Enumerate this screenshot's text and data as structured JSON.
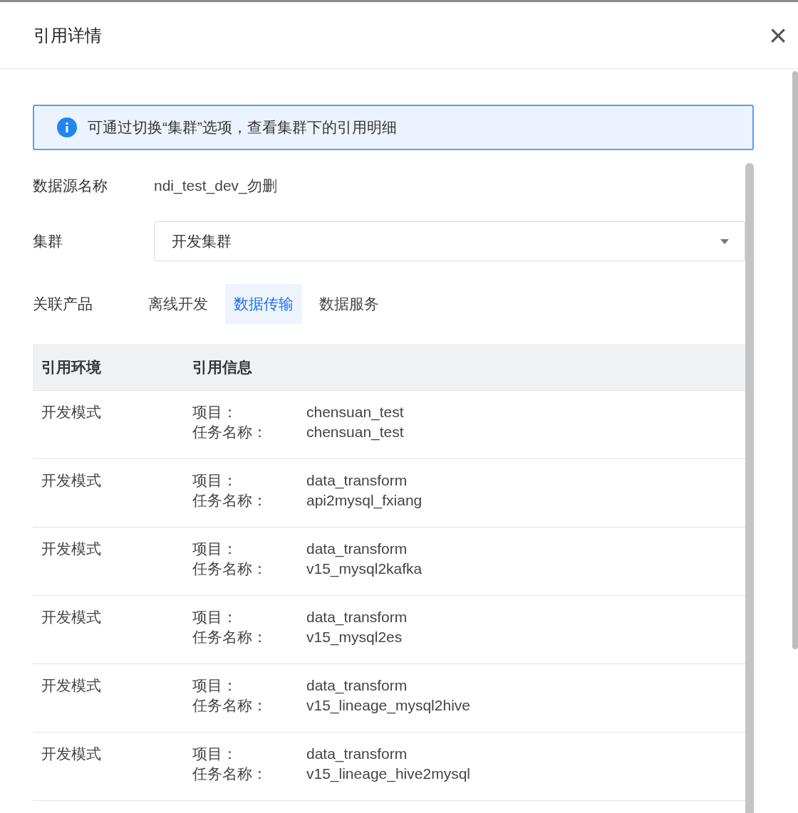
{
  "dialog": {
    "title": "引用详情",
    "close": "×"
  },
  "info": {
    "text": "可通过切换“集群”选项，查看集群下的引用明细"
  },
  "datasource": {
    "label": "数据源名称",
    "value": "ndi_test_dev_勿删"
  },
  "cluster": {
    "label": "集群",
    "value": "开发集群"
  },
  "products": {
    "label": "关联产品",
    "tabs": [
      {
        "label": "离线开发",
        "selected": false
      },
      {
        "label": "数据传输",
        "selected": true
      },
      {
        "label": "数据服务",
        "selected": false
      }
    ]
  },
  "table": {
    "columns": [
      "引用环境",
      "引用信息"
    ],
    "rows": [
      {
        "env": "开发模式",
        "project_label": "项目：",
        "project": "chensuan_test",
        "task_label": "任务名称：",
        "task": "chensuan_test"
      },
      {
        "env": "开发模式",
        "project_label": "项目：",
        "project": "data_transform",
        "task_label": "任务名称：",
        "task": "api2mysql_fxiang"
      },
      {
        "env": "开发模式",
        "project_label": "项目：",
        "project": "data_transform",
        "task_label": "任务名称：",
        "task": "v15_mysql2kafka"
      },
      {
        "env": "开发模式",
        "project_label": "项目：",
        "project": "data_transform",
        "task_label": "任务名称：",
        "task": "v15_mysql2es"
      },
      {
        "env": "开发模式",
        "project_label": "项目：",
        "project": "data_transform",
        "task_label": "任务名称：",
        "task": "v15_lineage_mysql2hive"
      },
      {
        "env": "开发模式",
        "project_label": "项目：",
        "project": "data_transform",
        "task_label": "任务名称：",
        "task": "v15_lineage_hive2mysql"
      }
    ]
  }
}
